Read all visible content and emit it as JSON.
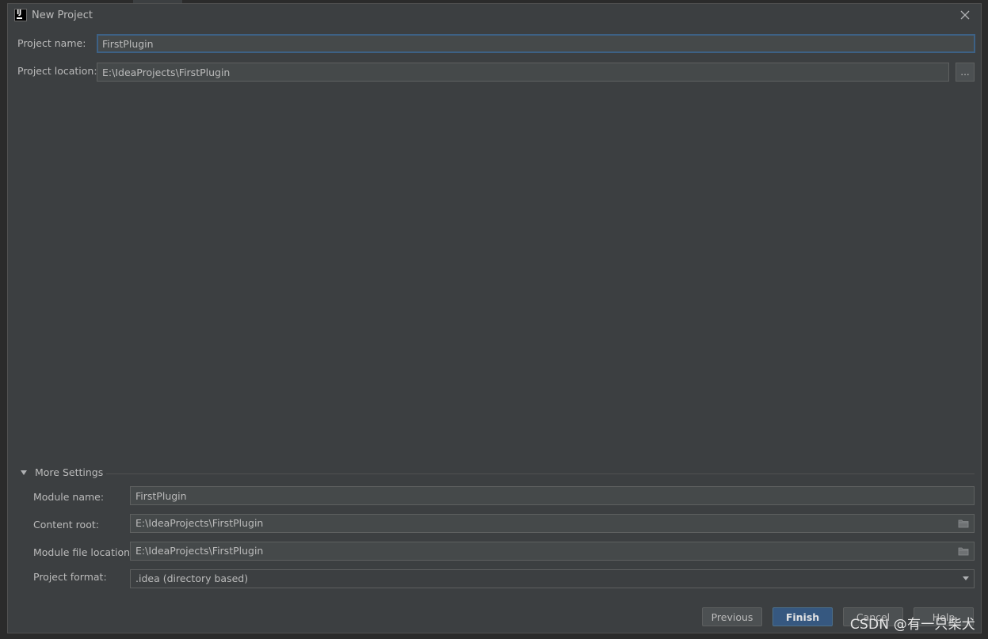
{
  "window": {
    "title": "New Project"
  },
  "project": {
    "name_label": "Project name:",
    "name_value": "FirstPlugin",
    "location_label": "Project location:",
    "location_value": "E:\\IdeaProjects\\FirstPlugin",
    "browse_label": "..."
  },
  "more_settings": {
    "label": "More Settings",
    "module_name_label": "Module name:",
    "module_name_value": "FirstPlugin",
    "content_root_label": "Content root:",
    "content_root_value": "E:\\IdeaProjects\\FirstPlugin",
    "module_file_location_label": "Module file location:",
    "module_file_location_value": "E:\\IdeaProjects\\FirstPlugin",
    "project_format_label": "Project format:",
    "project_format_value": ".idea (directory based)"
  },
  "buttons": {
    "previous": "Previous",
    "finish": "Finish",
    "cancel": "Cancel",
    "help": "Help"
  },
  "watermark": "CSDN @有一只柴犬",
  "colors": {
    "dialog_bg": "#3c3f41",
    "field_bg": "#45494a",
    "focus_border": "#3d6185",
    "primary_button": "#365880",
    "text": "#bbbbbb"
  }
}
